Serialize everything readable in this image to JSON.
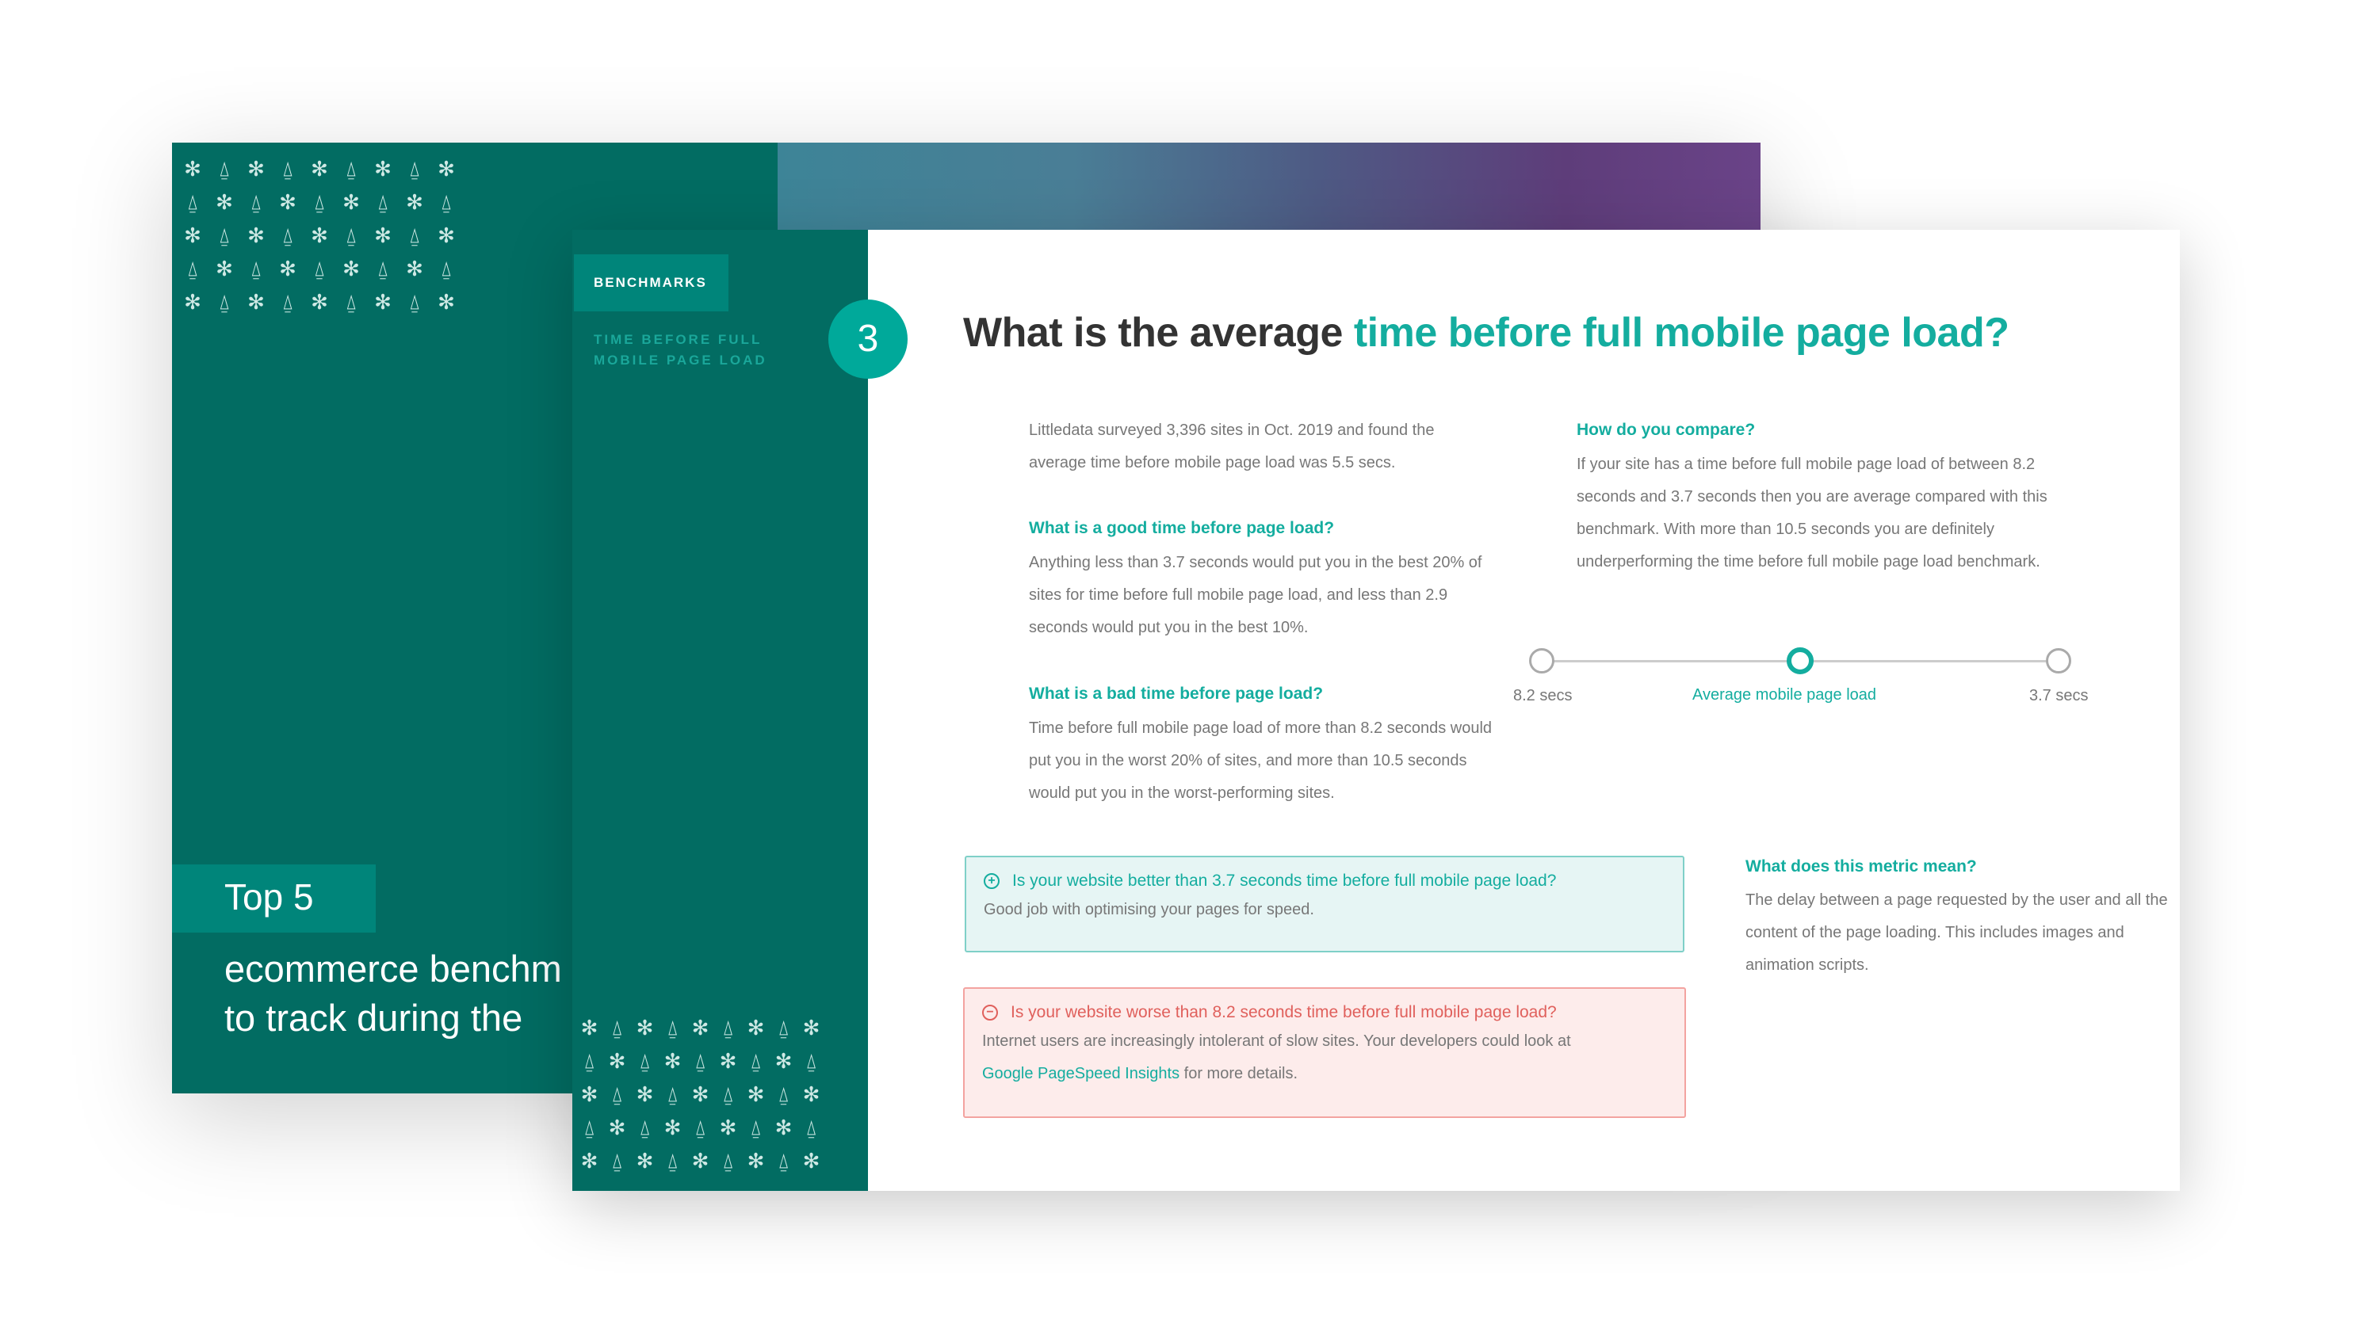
{
  "cover": {
    "tag": "Top 5",
    "line1": "ecommerce benchm",
    "line2": "to track during the"
  },
  "sidebar": {
    "tab": "BENCHMARKS",
    "subtitle": "TIME BEFORE FULL MOBILE PAGE LOAD"
  },
  "page": {
    "number": "3",
    "title_plain": "What is the average ",
    "title_accent": "time before full mobile page load?"
  },
  "intro": "Littledata surveyed 3,396 sites in Oct. 2019 and found the average time before mobile page load was 5.5 secs.",
  "good": {
    "heading": "What is a good time before page load?",
    "text": "Anything less than 3.7 seconds would put you in the best 20% of sites for time before full mobile page load, and less than 2.9 seconds would put you in the best 10%."
  },
  "bad": {
    "heading": "What is a bad time before page load?",
    "text": "Time before full mobile page load of more than 8.2 seconds would put you in the worst 20% of sites, and more than 10.5 seconds would put you in the worst-performing sites."
  },
  "compare": {
    "heading": "How do you compare?",
    "text": "If your site has a time before full mobile page load of between 8.2 seconds and 3.7 seconds then you are average compared with this benchmark. With more than 10.5 seconds you are definitely underperforming the time before full mobile page load benchmark."
  },
  "scale": {
    "left": "8.2 secs",
    "middle": "Average mobile page load",
    "right": "3.7 secs",
    "selected": "middle"
  },
  "good_box": {
    "icon": "plus-circle-icon",
    "question": "Is your website better than 3.7 seconds time before full mobile page load?",
    "text": "Good job with optimising your pages for speed."
  },
  "bad_box": {
    "icon": "minus-circle-icon",
    "question": "Is your website worse than 8.2 seconds time before full mobile page load?",
    "text": "Internet users are increasingly intolerant of slow sites. Your developers could look at",
    "link": "Google PageSpeed Insights",
    "text_after": " for more details."
  },
  "metric": {
    "heading": "What does this metric mean?",
    "text": "The delay between a page requested by the user and all the content of the page loading. This includes images and animation scripts."
  },
  "colors": {
    "teal_dark": "#026c62",
    "teal": "#00a99a",
    "accent_text": "#14ad9f",
    "good_bg": "#e6f5f4",
    "bad_bg": "#fdeceb",
    "bad_text": "#e0605c"
  }
}
